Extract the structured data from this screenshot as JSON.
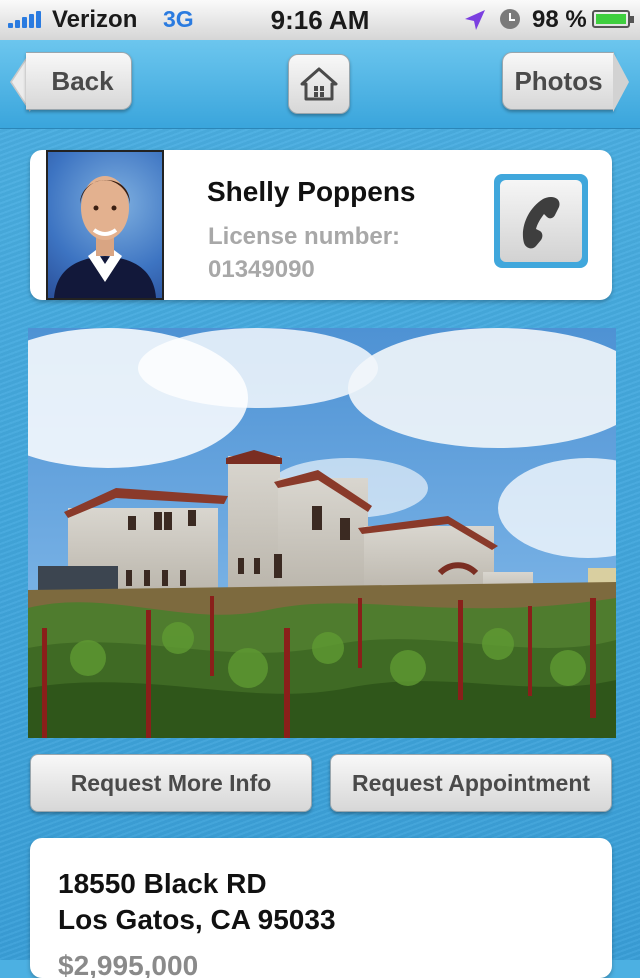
{
  "status_bar": {
    "carrier": "Verizon",
    "network": "3G",
    "time": "9:16 AM",
    "battery": "98 %",
    "battery_level": 0.98,
    "icons": [
      "signal-icon",
      "location-icon",
      "alarm-icon",
      "battery-icon"
    ]
  },
  "nav": {
    "back_label": "Back",
    "home_icon": "home-icon",
    "photos_label": "Photos"
  },
  "agent": {
    "name": "Shelly Poppens",
    "license_label": "License number:",
    "license_number": "01349090",
    "call_icon": "phone-icon"
  },
  "actions": {
    "more_info_label": "Request More Info",
    "appointment_label": "Request Appointment"
  },
  "property": {
    "address_line1": "18550 Black RD",
    "address_line2": "Los Gatos, CA 95033",
    "price": "$2,995,000"
  },
  "colors": {
    "background": "#3a9fd8",
    "network": "#2a7be0",
    "call_button": "#40a7dc"
  }
}
